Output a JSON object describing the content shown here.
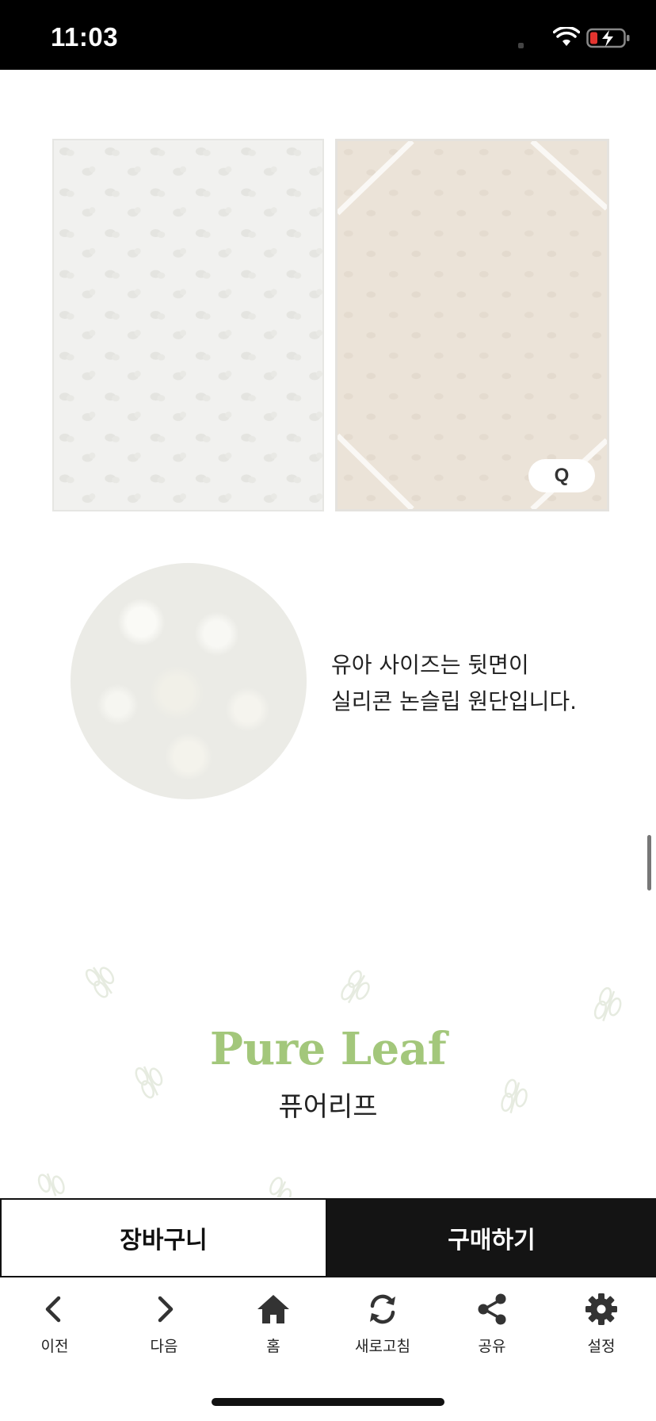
{
  "status_bar": {
    "time": "11:03"
  },
  "product": {
    "size_badge": "Q",
    "fabric_text_line1": "유아 사이즈는 뒷면이",
    "fabric_text_line2": "실리콘 논슬립 원단입니다."
  },
  "brand": {
    "title": "Pure Leaf",
    "subtitle": "퓨어리프"
  },
  "actions": {
    "cart_label": "장바구니",
    "buy_label": "구매하기"
  },
  "nav": [
    {
      "icon": "chevron-left-icon",
      "label": "이전"
    },
    {
      "icon": "chevron-right-icon",
      "label": "다음"
    },
    {
      "icon": "home-icon",
      "label": "홈"
    },
    {
      "icon": "refresh-icon",
      "label": "새로고침"
    },
    {
      "icon": "share-icon",
      "label": "공유"
    },
    {
      "icon": "gear-icon",
      "label": "설정"
    }
  ],
  "colors": {
    "brand_green": "#a3c77b",
    "buy_bg": "#141414",
    "beige_fabric": "#ebe3d8"
  }
}
